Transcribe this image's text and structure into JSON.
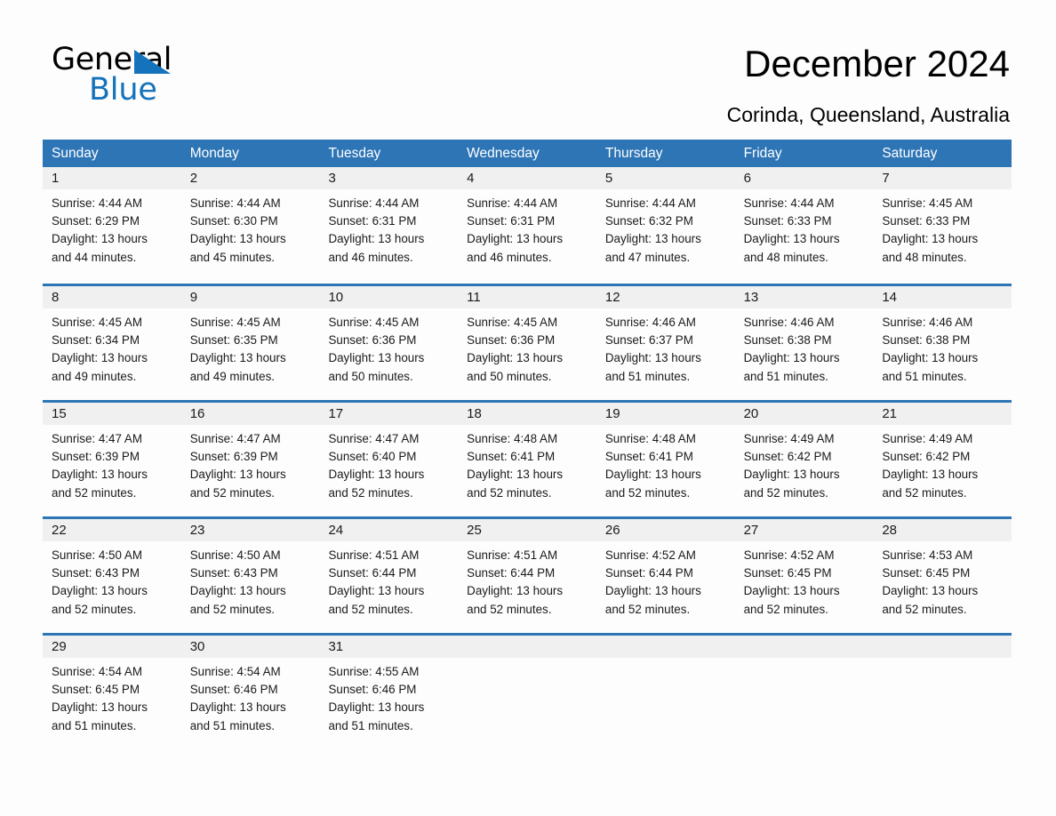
{
  "brand": {
    "name_part1": "General",
    "name_part2": "Blue",
    "color_black": "#000000",
    "color_blue": "#1573bb"
  },
  "header": {
    "title": "December 2024",
    "subtitle": "Corinda, Queensland, Australia"
  },
  "theme": {
    "header_blue": "#2e75b6",
    "day_band_gray": "#f0f0f0",
    "page_background": "#fdfdfd",
    "text_color": "#1a1a1a"
  },
  "weekdays": [
    "Sunday",
    "Monday",
    "Tuesday",
    "Wednesday",
    "Thursday",
    "Friday",
    "Saturday"
  ],
  "weeks": [
    [
      {
        "day": "1",
        "sunrise": "Sunrise: 4:44 AM",
        "sunset": "Sunset: 6:29 PM",
        "daylight_l1": "Daylight: 13 hours",
        "daylight_l2": "and 44 minutes."
      },
      {
        "day": "2",
        "sunrise": "Sunrise: 4:44 AM",
        "sunset": "Sunset: 6:30 PM",
        "daylight_l1": "Daylight: 13 hours",
        "daylight_l2": "and 45 minutes."
      },
      {
        "day": "3",
        "sunrise": "Sunrise: 4:44 AM",
        "sunset": "Sunset: 6:31 PM",
        "daylight_l1": "Daylight: 13 hours",
        "daylight_l2": "and 46 minutes."
      },
      {
        "day": "4",
        "sunrise": "Sunrise: 4:44 AM",
        "sunset": "Sunset: 6:31 PM",
        "daylight_l1": "Daylight: 13 hours",
        "daylight_l2": "and 46 minutes."
      },
      {
        "day": "5",
        "sunrise": "Sunrise: 4:44 AM",
        "sunset": "Sunset: 6:32 PM",
        "daylight_l1": "Daylight: 13 hours",
        "daylight_l2": "and 47 minutes."
      },
      {
        "day": "6",
        "sunrise": "Sunrise: 4:44 AM",
        "sunset": "Sunset: 6:33 PM",
        "daylight_l1": "Daylight: 13 hours",
        "daylight_l2": "and 48 minutes."
      },
      {
        "day": "7",
        "sunrise": "Sunrise: 4:45 AM",
        "sunset": "Sunset: 6:33 PM",
        "daylight_l1": "Daylight: 13 hours",
        "daylight_l2": "and 48 minutes."
      }
    ],
    [
      {
        "day": "8",
        "sunrise": "Sunrise: 4:45 AM",
        "sunset": "Sunset: 6:34 PM",
        "daylight_l1": "Daylight: 13 hours",
        "daylight_l2": "and 49 minutes."
      },
      {
        "day": "9",
        "sunrise": "Sunrise: 4:45 AM",
        "sunset": "Sunset: 6:35 PM",
        "daylight_l1": "Daylight: 13 hours",
        "daylight_l2": "and 49 minutes."
      },
      {
        "day": "10",
        "sunrise": "Sunrise: 4:45 AM",
        "sunset": "Sunset: 6:36 PM",
        "daylight_l1": "Daylight: 13 hours",
        "daylight_l2": "and 50 minutes."
      },
      {
        "day": "11",
        "sunrise": "Sunrise: 4:45 AM",
        "sunset": "Sunset: 6:36 PM",
        "daylight_l1": "Daylight: 13 hours",
        "daylight_l2": "and 50 minutes."
      },
      {
        "day": "12",
        "sunrise": "Sunrise: 4:46 AM",
        "sunset": "Sunset: 6:37 PM",
        "daylight_l1": "Daylight: 13 hours",
        "daylight_l2": "and 51 minutes."
      },
      {
        "day": "13",
        "sunrise": "Sunrise: 4:46 AM",
        "sunset": "Sunset: 6:38 PM",
        "daylight_l1": "Daylight: 13 hours",
        "daylight_l2": "and 51 minutes."
      },
      {
        "day": "14",
        "sunrise": "Sunrise: 4:46 AM",
        "sunset": "Sunset: 6:38 PM",
        "daylight_l1": "Daylight: 13 hours",
        "daylight_l2": "and 51 minutes."
      }
    ],
    [
      {
        "day": "15",
        "sunrise": "Sunrise: 4:47 AM",
        "sunset": "Sunset: 6:39 PM",
        "daylight_l1": "Daylight: 13 hours",
        "daylight_l2": "and 52 minutes."
      },
      {
        "day": "16",
        "sunrise": "Sunrise: 4:47 AM",
        "sunset": "Sunset: 6:39 PM",
        "daylight_l1": "Daylight: 13 hours",
        "daylight_l2": "and 52 minutes."
      },
      {
        "day": "17",
        "sunrise": "Sunrise: 4:47 AM",
        "sunset": "Sunset: 6:40 PM",
        "daylight_l1": "Daylight: 13 hours",
        "daylight_l2": "and 52 minutes."
      },
      {
        "day": "18",
        "sunrise": "Sunrise: 4:48 AM",
        "sunset": "Sunset: 6:41 PM",
        "daylight_l1": "Daylight: 13 hours",
        "daylight_l2": "and 52 minutes."
      },
      {
        "day": "19",
        "sunrise": "Sunrise: 4:48 AM",
        "sunset": "Sunset: 6:41 PM",
        "daylight_l1": "Daylight: 13 hours",
        "daylight_l2": "and 52 minutes."
      },
      {
        "day": "20",
        "sunrise": "Sunrise: 4:49 AM",
        "sunset": "Sunset: 6:42 PM",
        "daylight_l1": "Daylight: 13 hours",
        "daylight_l2": "and 52 minutes."
      },
      {
        "day": "21",
        "sunrise": "Sunrise: 4:49 AM",
        "sunset": "Sunset: 6:42 PM",
        "daylight_l1": "Daylight: 13 hours",
        "daylight_l2": "and 52 minutes."
      }
    ],
    [
      {
        "day": "22",
        "sunrise": "Sunrise: 4:50 AM",
        "sunset": "Sunset: 6:43 PM",
        "daylight_l1": "Daylight: 13 hours",
        "daylight_l2": "and 52 minutes."
      },
      {
        "day": "23",
        "sunrise": "Sunrise: 4:50 AM",
        "sunset": "Sunset: 6:43 PM",
        "daylight_l1": "Daylight: 13 hours",
        "daylight_l2": "and 52 minutes."
      },
      {
        "day": "24",
        "sunrise": "Sunrise: 4:51 AM",
        "sunset": "Sunset: 6:44 PM",
        "daylight_l1": "Daylight: 13 hours",
        "daylight_l2": "and 52 minutes."
      },
      {
        "day": "25",
        "sunrise": "Sunrise: 4:51 AM",
        "sunset": "Sunset: 6:44 PM",
        "daylight_l1": "Daylight: 13 hours",
        "daylight_l2": "and 52 minutes."
      },
      {
        "day": "26",
        "sunrise": "Sunrise: 4:52 AM",
        "sunset": "Sunset: 6:44 PM",
        "daylight_l1": "Daylight: 13 hours",
        "daylight_l2": "and 52 minutes."
      },
      {
        "day": "27",
        "sunrise": "Sunrise: 4:52 AM",
        "sunset": "Sunset: 6:45 PM",
        "daylight_l1": "Daylight: 13 hours",
        "daylight_l2": "and 52 minutes."
      },
      {
        "day": "28",
        "sunrise": "Sunrise: 4:53 AM",
        "sunset": "Sunset: 6:45 PM",
        "daylight_l1": "Daylight: 13 hours",
        "daylight_l2": "and 52 minutes."
      }
    ],
    [
      {
        "day": "29",
        "sunrise": "Sunrise: 4:54 AM",
        "sunset": "Sunset: 6:45 PM",
        "daylight_l1": "Daylight: 13 hours",
        "daylight_l2": "and 51 minutes."
      },
      {
        "day": "30",
        "sunrise": "Sunrise: 4:54 AM",
        "sunset": "Sunset: 6:46 PM",
        "daylight_l1": "Daylight: 13 hours",
        "daylight_l2": "and 51 minutes."
      },
      {
        "day": "31",
        "sunrise": "Sunrise: 4:55 AM",
        "sunset": "Sunset: 6:46 PM",
        "daylight_l1": "Daylight: 13 hours",
        "daylight_l2": "and 51 minutes."
      },
      {
        "day": "",
        "sunrise": "",
        "sunset": "",
        "daylight_l1": "",
        "daylight_l2": ""
      },
      {
        "day": "",
        "sunrise": "",
        "sunset": "",
        "daylight_l1": "",
        "daylight_l2": ""
      },
      {
        "day": "",
        "sunrise": "",
        "sunset": "",
        "daylight_l1": "",
        "daylight_l2": ""
      },
      {
        "day": "",
        "sunrise": "",
        "sunset": "",
        "daylight_l1": "",
        "daylight_l2": ""
      }
    ]
  ]
}
